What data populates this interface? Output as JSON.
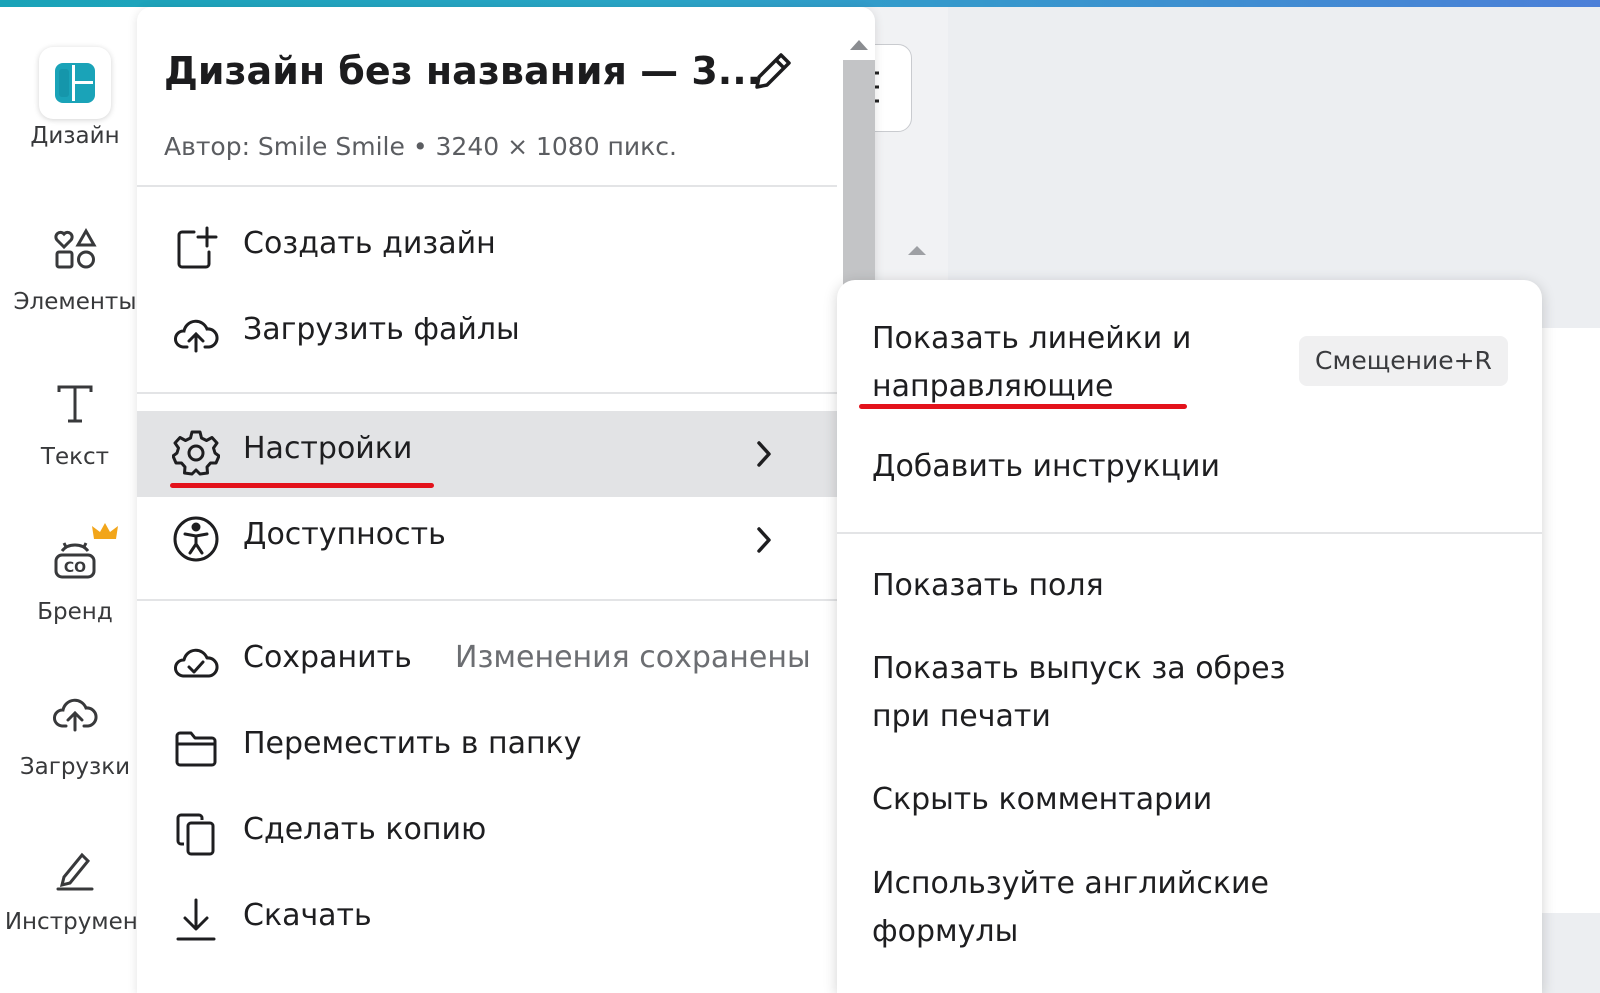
{
  "rail": {
    "items": [
      {
        "label": "Дизайн",
        "icon": "design-icon"
      },
      {
        "label": "Элементы",
        "icon": "elements-icon"
      },
      {
        "label": "Текст",
        "icon": "text-icon"
      },
      {
        "label": "Бренд",
        "icon": "brand-icon"
      },
      {
        "label": "Загрузки",
        "icon": "uploads-icon"
      },
      {
        "label": "Инструмен.",
        "icon": "tools-icon"
      }
    ],
    "accent": "#1aa3b8",
    "crown_color": "#f2a51a"
  },
  "menu": {
    "title": "Дизайн без названия — 3...",
    "subtitle": "Автор: Smile Smile • 3240 × 1080 пикс.",
    "items": [
      {
        "label": "Создать дизайн",
        "icon": "create-design-icon"
      },
      {
        "label": "Загрузить файлы",
        "icon": "upload-cloud-icon"
      },
      {
        "label": "Настройки",
        "icon": "settings-gear-icon"
      },
      {
        "label": "Доступность",
        "icon": "accessibility-icon"
      },
      {
        "label": "Сохранить",
        "icon": "save-cloud-check-icon",
        "status": "Изменения сохранены"
      },
      {
        "label": "Переместить в папку",
        "icon": "folder-icon"
      },
      {
        "label": "Сделать копию",
        "icon": "copy-icon"
      },
      {
        "label": "Скачать",
        "icon": "download-icon"
      }
    ]
  },
  "submenu": {
    "items": [
      {
        "label": "Показать линейки и направляющие",
        "shortcut": "Смещение+R"
      },
      {
        "label": "Добавить инструкции"
      },
      {
        "label": "Показать поля"
      },
      {
        "label": "Показать выпуск за обрез при печати"
      },
      {
        "label": "Скрыть комментарии"
      },
      {
        "label": "Используйте английские формулы"
      }
    ]
  },
  "annotation_color": "#e3121b"
}
